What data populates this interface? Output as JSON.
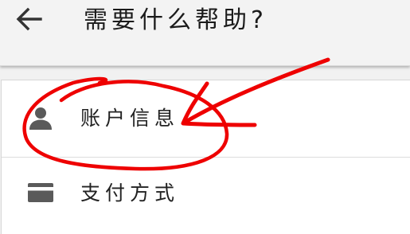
{
  "header": {
    "title": "需要什么帮助?",
    "back_icon": "arrow-left-icon"
  },
  "menu": {
    "items": [
      {
        "label": "账户信息",
        "icon": "person-icon"
      },
      {
        "label": "支付方式",
        "icon": "credit-card-icon"
      }
    ]
  },
  "annotation": {
    "color": "#ee0000",
    "shapes": [
      "circle-around-account-info",
      "arrow-pointing-to-account-info"
    ]
  },
  "colors": {
    "header_bg": "#f3f3f3",
    "list_bg": "#ffffff",
    "icon": "#5a5a5a",
    "text": "#1b1b1b"
  }
}
